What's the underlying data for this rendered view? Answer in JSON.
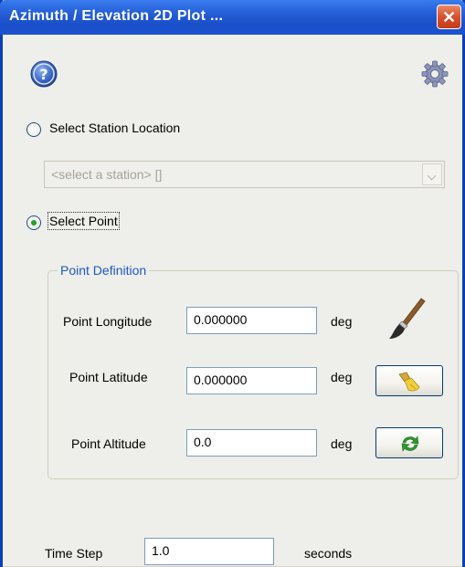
{
  "window": {
    "title": "Azimuth / Elevation 2D Plot ..."
  },
  "options": {
    "station_label": "Select Station Location",
    "station_select_value": "<select a station> []",
    "point_label": "Select Point"
  },
  "point_definition": {
    "legend": "Point Definition",
    "rows": [
      {
        "label": "Point Longitude",
        "value": "0.000000",
        "unit": "deg"
      },
      {
        "label": "Point Latitude",
        "value": "0.000000",
        "unit": "deg"
      },
      {
        "label": "Point Altitude",
        "value": "0.0",
        "unit": "deg"
      }
    ]
  },
  "time_step": {
    "label": "Time Step",
    "value": "1.0",
    "unit": "seconds"
  },
  "icons": {
    "help": "help-icon",
    "settings": "gear-icon",
    "pick": "paintbrush-icon",
    "clear": "broom-icon",
    "refresh": "refresh-icon"
  },
  "colors": {
    "title_bar": "#1c52cf",
    "legend_text": "#1d59c5",
    "selected_radio": "#21a121"
  }
}
